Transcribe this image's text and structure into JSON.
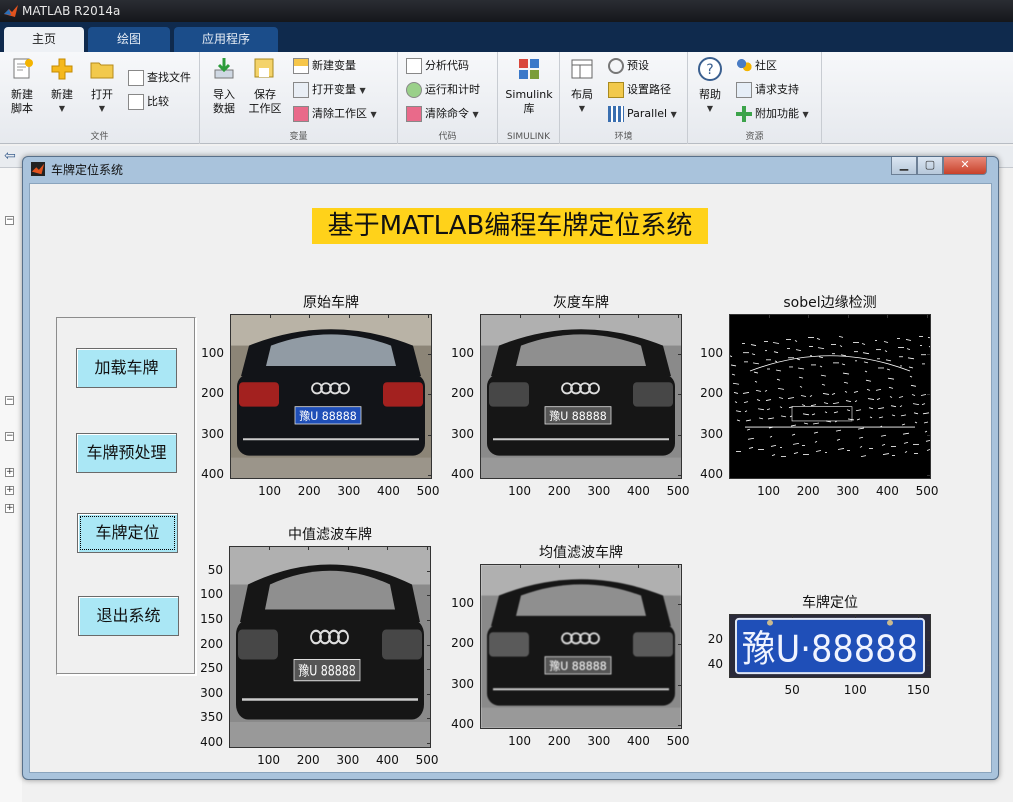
{
  "window": {
    "title": "MATLAB R2014a"
  },
  "ribbon_tabs": [
    {
      "label": "主页"
    },
    {
      "label": "绘图"
    },
    {
      "label": "应用程序"
    }
  ],
  "ribbon": {
    "groups": [
      {
        "title": "文件"
      },
      {
        "title": "变量"
      },
      {
        "title": "代码"
      },
      {
        "title": "SIMULINK"
      },
      {
        "title": "环境"
      },
      {
        "title": "资源"
      }
    ],
    "new_script": "新建\n脚本",
    "new": "新建",
    "open": "打开",
    "find_files": "查找文件",
    "compare": "比较",
    "import": "导入\n数据",
    "save_ws": "保存\n工作区",
    "new_var": "新建变量",
    "open_var": "打开变量",
    "clear_ws": "清除工作区",
    "analyze": "分析代码",
    "run_time": "运行和计时",
    "clear_cmd": "清除命令",
    "simulink": "Simulink\n库",
    "layout": "布局",
    "prefs": "预设",
    "set_path": "设置路径",
    "parallel": "Parallel",
    "help": "帮助",
    "community": "社区",
    "request_support": "请求支持",
    "addons": "附加功能"
  },
  "figure": {
    "title": "车牌定位系统",
    "heading": "基于MATLAB编程车牌定位系统",
    "buttons": [
      {
        "label": "加载车牌"
      },
      {
        "label": "车牌预处理"
      },
      {
        "label": "车牌定位"
      },
      {
        "label": "退出系统"
      }
    ],
    "axes": [
      {
        "title": "原始车牌",
        "yticks": [
          "100",
          "200",
          "300",
          "400"
        ],
        "xticks": [
          "100",
          "200",
          "300",
          "400",
          "500"
        ]
      },
      {
        "title": "灰度车牌",
        "yticks": [
          "100",
          "200",
          "300",
          "400"
        ],
        "xticks": [
          "100",
          "200",
          "300",
          "400",
          "500"
        ]
      },
      {
        "title": "sobel边缘检测",
        "yticks": [
          "100",
          "200",
          "300",
          "400"
        ],
        "xticks": [
          "100",
          "200",
          "300",
          "400",
          "500"
        ]
      },
      {
        "title": "中值滤波车牌",
        "yticks": [
          "50",
          "100",
          "150",
          "200",
          "250",
          "300",
          "350",
          "400"
        ],
        "xticks": [
          "100",
          "200",
          "300",
          "400",
          "500"
        ]
      },
      {
        "title": "均值滤波车牌",
        "yticks": [
          "100",
          "200",
          "300",
          "400"
        ],
        "xticks": [
          "100",
          "200",
          "300",
          "400",
          "500"
        ]
      },
      {
        "title": "车牌定位",
        "yticks": [
          "20",
          "40"
        ],
        "xticks": [
          "50",
          "100",
          "150"
        ]
      }
    ],
    "plate_text": "豫U·88888",
    "plate_text_small": "豫U 88888"
  },
  "colors": {
    "heading_bg": "#ffd21a",
    "button_bg": "#aae7f5",
    "plate_blue": "#1f4fb8"
  }
}
